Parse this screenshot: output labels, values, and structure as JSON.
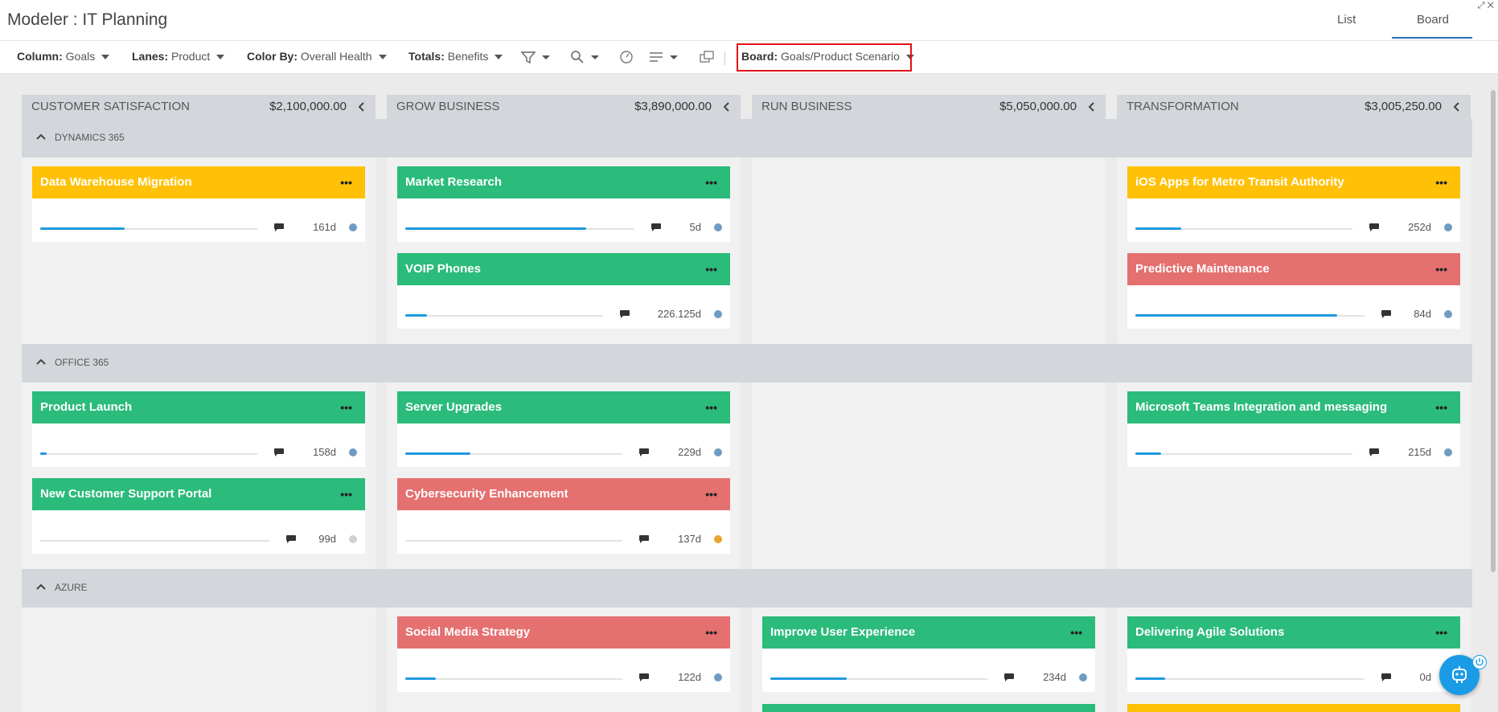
{
  "app": {
    "title": "Modeler : IT Planning"
  },
  "view_tabs": {
    "list": "List",
    "board": "Board"
  },
  "toolbar": {
    "column": {
      "label": "Column:",
      "value": "Goals"
    },
    "lanes": {
      "label": "Lanes:",
      "value": "Product"
    },
    "color_by": {
      "label": "Color By:",
      "value": "Overall Health"
    },
    "totals": {
      "label": "Totals:",
      "value": "Benefits"
    },
    "board": {
      "label": "Board:",
      "value": "Goals/Product Scenario"
    }
  },
  "colors": {
    "green": "#2bbb7b",
    "yellow": "#ffc107",
    "red": "#e57070",
    "blue": "#1e9ae0",
    "dot_blue": "#6f9cc3",
    "dot_gray": "#d0d0d0",
    "dot_orange": "#e8a330",
    "highlight": "#e0101a"
  },
  "columns": [
    {
      "title": "CUSTOMER SATISFACTION",
      "total": "$2,100,000.00"
    },
    {
      "title": "GROW BUSINESS",
      "total": "$3,890,000.00"
    },
    {
      "title": "RUN BUSINESS",
      "total": "$5,050,000.00"
    },
    {
      "title": "TRANSFORMATION",
      "total": "$3,005,250.00"
    }
  ],
  "lanes": [
    {
      "label": "DYNAMICS 365"
    },
    {
      "label": "OFFICE 365"
    },
    {
      "label": "AZURE"
    }
  ],
  "cards": [
    {
      "title": "Data Warehouse Migration",
      "color": "yellow",
      "progress": 0.39,
      "duration": "161d",
      "status": "blue"
    },
    {
      "title": "Market Research",
      "color": "green",
      "progress": 0.79,
      "duration": "5d",
      "status": "blue"
    },
    {
      "title": "VOIP Phones",
      "color": "green",
      "progress": 0.11,
      "duration": "226.125d",
      "status": "blue"
    },
    {
      "title": "iOS Apps for Metro Transit Authority",
      "color": "yellow",
      "progress": 0.21,
      "duration": "252d",
      "status": "blue"
    },
    {
      "title": "Predictive Maintenance",
      "color": "red",
      "progress": 0.88,
      "duration": "84d",
      "status": "blue"
    },
    {
      "title": "Product Launch",
      "color": "green",
      "progress": 0.03,
      "duration": "158d",
      "status": "blue"
    },
    {
      "title": "New Customer Support Portal",
      "color": "green",
      "progress": 0.0,
      "duration": "99d",
      "status": "gray"
    },
    {
      "title": "Server Upgrades",
      "color": "green",
      "progress": 0.3,
      "duration": "229d",
      "status": "blue"
    },
    {
      "title": "Cybersecurity Enhancement",
      "color": "red",
      "progress": 0.0,
      "duration": "137d",
      "status": "orange"
    },
    {
      "title": "Microsoft Teams Integration and messaging",
      "color": "green",
      "progress": 0.12,
      "duration": "215d",
      "status": "blue"
    },
    {
      "title": "Social Media Strategy",
      "color": "red",
      "progress": 0.14,
      "duration": "122d",
      "status": "blue"
    },
    {
      "title": "Improve User Experience",
      "color": "green",
      "progress": 0.35,
      "duration": "234d",
      "status": "blue"
    },
    {
      "title": "Delivering Agile Solutions",
      "color": "green",
      "progress": 0.13,
      "duration": "0d",
      "status": "blue"
    }
  ]
}
